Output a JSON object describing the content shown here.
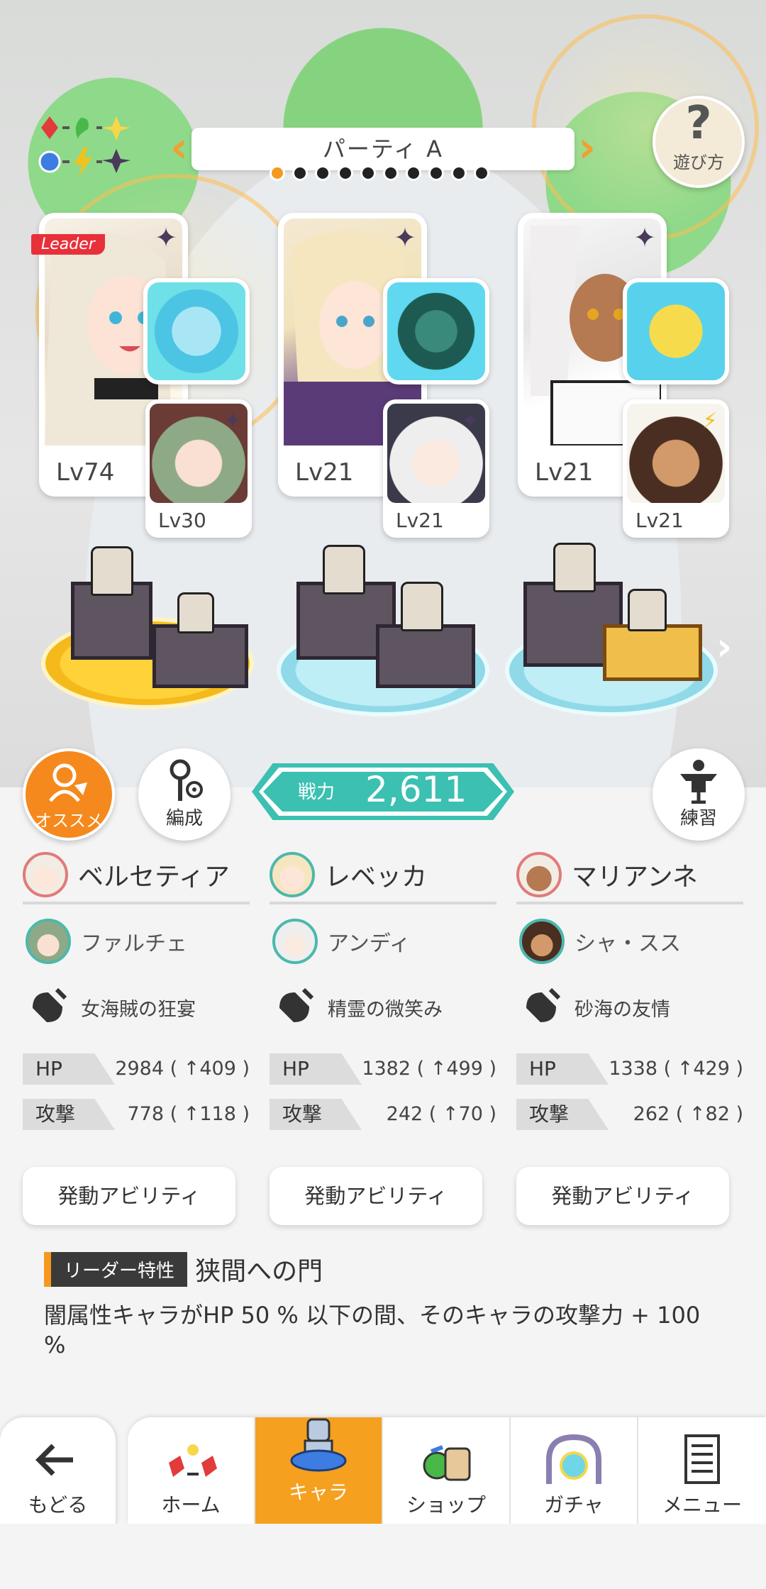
{
  "party": {
    "name": "パーティ A",
    "dot_count": 10,
    "active_index": 0
  },
  "help": {
    "label": "遊び方",
    "symbol": "?"
  },
  "leader_tag": "Leader",
  "team": [
    {
      "main": {
        "name": "ベルセティア",
        "level": "Lv74",
        "element_icon": "dark-star-icon"
      },
      "sub": {
        "name": "ファルチェ",
        "level": "Lv30",
        "element_icon": "dark-star-icon"
      },
      "weapon": "女海賊の狂宴",
      "hp_label": "HP",
      "hp": "2984 ( ↑409 )",
      "atk_label": "攻撃",
      "atk": "778 ( ↑118 )",
      "ability_label": "発動アビリティ"
    },
    {
      "main": {
        "name": "レベッカ",
        "level": "Lv21",
        "element_icon": "dark-star-icon"
      },
      "sub": {
        "name": "アンディ",
        "level": "Lv21",
        "element_icon": "dark-star-icon"
      },
      "weapon": "精霊の微笑み",
      "hp_label": "HP",
      "hp": "1382 ( ↑499 )",
      "atk_label": "攻撃",
      "atk": "242 ( ↑70 )",
      "ability_label": "発動アビリティ"
    },
    {
      "main": {
        "name": "マリアンネ",
        "level": "Lv21",
        "element_icon": "dark-star-icon"
      },
      "sub": {
        "name": "シャ・スス",
        "level": "Lv21",
        "element_icon": "lightning-icon"
      },
      "weapon": "砂海の友情",
      "hp_label": "HP",
      "hp": "1338 ( ↑429 )",
      "atk_label": "攻撃",
      "atk": "262 ( ↑82 )",
      "ability_label": "発動アビリティ"
    }
  ],
  "buttons": {
    "recommend": "オススメ",
    "formation": "編成",
    "practice": "練習"
  },
  "power": {
    "label": "戦力",
    "value": "2,611"
  },
  "leader_skill": {
    "tag": "リーダー特性",
    "title": "狭間への門",
    "description": "闇属性キャラがHP 50 % 以下の間、そのキャラの攻撃力 + 100 %"
  },
  "nav": {
    "back": "もどる",
    "tabs": [
      "ホーム",
      "キャラ",
      "ショップ",
      "ガチャ",
      "メニュー"
    ],
    "active": "キャラ"
  },
  "colors": {
    "accent_orange": "#f5981e",
    "teal": "#3bc0b2",
    "dark_star": "#4a3a5c"
  }
}
